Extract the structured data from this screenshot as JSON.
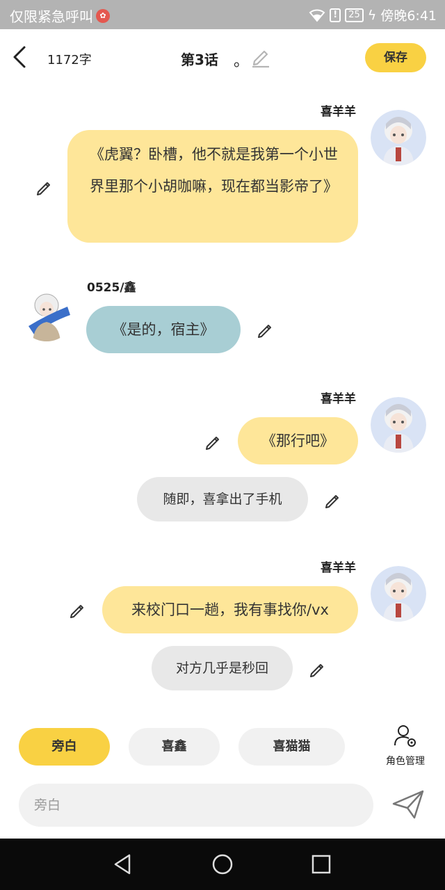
{
  "status_bar": {
    "carrier_text": "仅限紧急呼叫",
    "battery": "25",
    "time": "傍晚6:41"
  },
  "header": {
    "word_count": "1172字",
    "chapter_title": "第3话",
    "chapter_suffix": "。",
    "save_label": "保存"
  },
  "messages": [
    {
      "speaker": "喜羊羊",
      "text": "《虎翼？卧槽，他不就是我第一个小世界里那个小胡咖嘛，现在都当影帝了》",
      "side": "right",
      "style": "speech"
    },
    {
      "speaker": "0525/鑫",
      "text": "《是的，宿主》",
      "side": "left",
      "style": "speech"
    },
    {
      "speaker": "喜羊羊",
      "text": "《那行吧》",
      "side": "right",
      "style": "speech"
    },
    {
      "speaker": "",
      "text": "随即，喜拿出了手机",
      "side": "center",
      "style": "narration"
    },
    {
      "speaker": "喜羊羊",
      "text": "来校门口一趟，我有事找你/vx",
      "side": "right",
      "style": "speech"
    },
    {
      "speaker": "",
      "text": "对方几乎是秒回",
      "side": "center",
      "style": "narration"
    }
  ],
  "roles": {
    "chips": [
      "旁白",
      "喜鑫",
      "喜猫猫"
    ],
    "active_index": 0,
    "manage_label": "角色管理"
  },
  "input": {
    "placeholder": "旁白"
  },
  "colors": {
    "accent": "#f9d143",
    "speech_bubble_right": "#fee699",
    "speech_bubble_left": "#a8ced4",
    "narration_bubble": "#e8e8e8"
  },
  "icons": [
    "back-arrow-icon",
    "edit-pencil-icon",
    "send-icon",
    "user-gear-icon"
  ]
}
